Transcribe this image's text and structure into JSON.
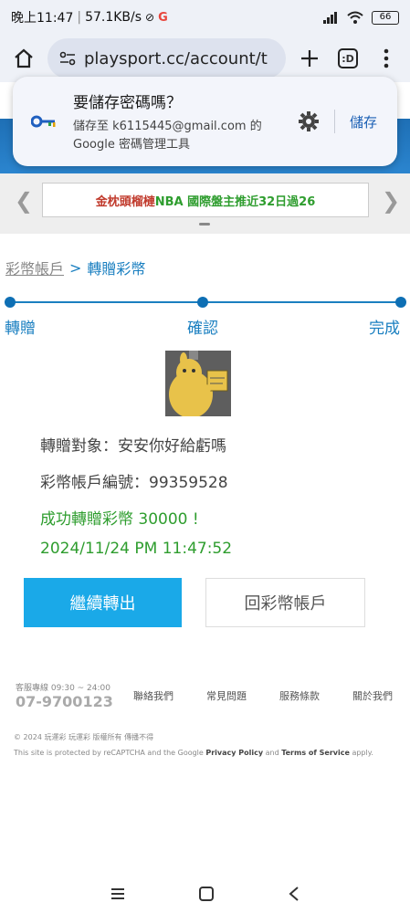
{
  "status_bar": {
    "time": "晚上11:47",
    "speed": "57.1KB/s",
    "battery": "66"
  },
  "browser": {
    "url": "playsport.cc/account/t",
    "tabs_count": ":D"
  },
  "password_popup": {
    "title": "要儲存密碼嗎？",
    "line1": "儲存至 k6115445@gmail.com 的",
    "line2": "Google 密碼管理工具",
    "save_label": "儲存"
  },
  "banner": {
    "text_red": "金枕頭榴槤",
    "text_green": " NBA 國際盤主推近32日過26"
  },
  "breadcrumb": {
    "parent": "彩幣帳戶",
    "separator": ">",
    "current": "轉贈彩幣"
  },
  "steps": {
    "step1": "轉贈",
    "step2": "確認",
    "step3": "完成"
  },
  "result": {
    "target": "轉贈對象：安安你好給虧嗎",
    "account": "彩幣帳戶編號：99359528",
    "success": "成功轉贈彩幣 30000 !",
    "timestamp": "2024/11/24 PM 11:47:52"
  },
  "buttons": {
    "continue": "繼續轉出",
    "back": "回彩幣帳戶"
  },
  "footer": {
    "hours": "客服專線 09:30 ~ 24:00",
    "phone": "07-9700123",
    "links": [
      "聯絡我們",
      "常見問題",
      "服務條款",
      "關於我們"
    ],
    "copyright": "© 2024 玩運彩 玩運彩 版權所有 傳播不得",
    "recaptcha_prefix": "This site is protected by reCAPTCHA and the Google ",
    "privacy": "Privacy Policy",
    "and": " and ",
    "terms": "Terms of Service",
    "apply": " apply."
  },
  "colors": {
    "accent_blue": "#1a7fc0",
    "button_blue": "#1aa9e8",
    "success_green": "#2e9d2e",
    "banner_red": "#c0392b"
  }
}
